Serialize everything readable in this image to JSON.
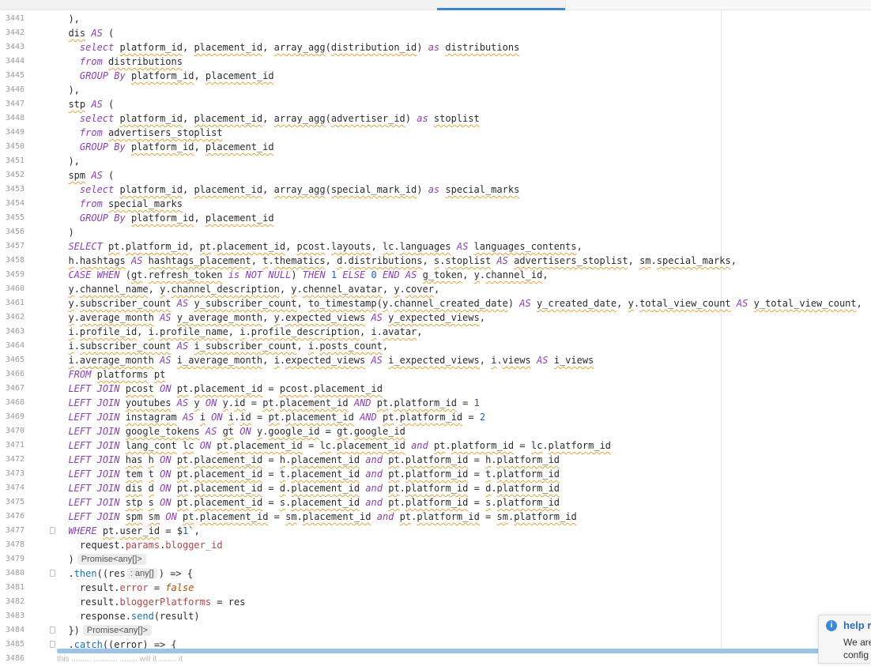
{
  "notification": {
    "title": "help r",
    "line1": "We are",
    "line2": "config"
  },
  "status_ghost": "this ......... ........... ........ will it ........ it",
  "hints": {
    "promise": "Promise<any[]>",
    "any_array": ": any[]"
  },
  "lines": [
    {
      "n": "3441",
      "text": "  ),"
    },
    {
      "n": "3442",
      "text": "  dis AS ("
    },
    {
      "n": "3443",
      "text": "    select platform_id, placement_id, array_agg(distribution_id) as distributions"
    },
    {
      "n": "3444",
      "text": "    from distributions"
    },
    {
      "n": "3445",
      "text": "    GROUP By platform_id, placement_id"
    },
    {
      "n": "3446",
      "text": "  ),"
    },
    {
      "n": "3447",
      "text": "  stp AS ("
    },
    {
      "n": "3448",
      "text": "    select platform_id, placement_id, array_agg(advertiser_id) as stoplist"
    },
    {
      "n": "3449",
      "text": "    from advertisers_stoplist"
    },
    {
      "n": "3450",
      "text": "    GROUP By platform_id, placement_id"
    },
    {
      "n": "3451",
      "text": "  ),"
    },
    {
      "n": "3452",
      "text": "  spm AS ("
    },
    {
      "n": "3453",
      "text": "    select platform_id, placement_id, array_agg(special_mark_id) as special_marks"
    },
    {
      "n": "3454",
      "text": "    from special_marks"
    },
    {
      "n": "3455",
      "text": "    GROUP By platform_id, placement_id"
    },
    {
      "n": "3456",
      "text": "  )"
    },
    {
      "n": "3457",
      "text": "  SELECT pt.platform_id, pt.placement_id, pcost.layouts, lc.languages AS languages_contents,"
    },
    {
      "n": "3458",
      "text": "  h.hashtags AS hashtags_placement, t.thematics, d.distributions, s.stoplist AS advertisers_stoplist, sm.special_marks,"
    },
    {
      "n": "3459",
      "text": "  CASE WHEN (gt.refresh_token is NOT NULL) THEN 1 ELSE 0 END AS g_token, y.channel_id,"
    },
    {
      "n": "3460",
      "text": "  y.channel_name, y.channel_description, y.chennel_avatar, y.cover,"
    },
    {
      "n": "3461",
      "text": "  y.subscriber_count AS y_subscriber_count, to_timestamp(y.channel_created_date) AS y_created_date, y.total_view_count AS y_total_view_count,"
    },
    {
      "n": "3462",
      "text": "  y.average_month AS y_average_month, y.expected_views AS y_expected_views,"
    },
    {
      "n": "3463",
      "text": "  i.profile_id, i.profile_name, i.profile_description, i.avatar,"
    },
    {
      "n": "3464",
      "text": "  i.subscriber_count AS i_subscriber_count, i.posts_count,"
    },
    {
      "n": "3465",
      "text": "  i.average_month AS i_average_month, i.expected_views AS i_expected_views, i.views AS i_views"
    },
    {
      "n": "3466",
      "text": "  FROM platforms pt"
    },
    {
      "n": "3467",
      "text": "  LEFT JOIN pcost ON pt.placement_id = pcost.placement_id"
    },
    {
      "n": "3468",
      "text": "  LEFT JOIN youtubes AS y ON y.id = pt.placement_id AND pt.platform_id = 1"
    },
    {
      "n": "3469",
      "text": "  LEFT JOIN instagram AS i ON i.id = pt.placement_id AND pt.platform_id = 2"
    },
    {
      "n": "3470",
      "text": "  LEFT JOIN google_tokens AS gt ON y.google_id = gt.google_id"
    },
    {
      "n": "3471",
      "text": "  LEFT JOIN lang_cont lc ON pt.placement_id = lc.placement_id and pt.platform_id = lc.platform_id"
    },
    {
      "n": "3472",
      "text": "  LEFT JOIN has h ON pt.placement_id = h.placement_id and pt.platform_id = h.platform_id"
    },
    {
      "n": "3473",
      "text": "  LEFT JOIN tem t ON pt.placement_id = t.placement_id and pt.platform_id = t.platform_id"
    },
    {
      "n": "3474",
      "text": "  LEFT JOIN dis d ON pt.placement_id = d.placement_id and pt.platform_id = d.platform_id"
    },
    {
      "n": "3475",
      "text": "  LEFT JOIN stp s ON pt.placement_id = s.placement_id and pt.platform_id = s.platform_id"
    },
    {
      "n": "3476",
      "text": "  LEFT JOIN spm sm ON pt.placement_id = sm.placement_id and pt.platform_id = sm.platform_id"
    },
    {
      "n": "3477",
      "text": "  WHERE pt.user_id = $1`,"
    },
    {
      "n": "3478",
      "text": "    request.params.blogger_id"
    },
    {
      "n": "3479",
      "text": "  )"
    },
    {
      "n": "3480",
      "text": "  .then((res) => {"
    },
    {
      "n": "3481",
      "text": "    result.error = false"
    },
    {
      "n": "3482",
      "text": "    result.bloggerPlatforms = res"
    },
    {
      "n": "3483",
      "text": "    response.send(result)"
    },
    {
      "n": "3484",
      "text": "  })"
    },
    {
      "n": "3485",
      "text": "  .catch((error) => {"
    },
    {
      "n": "3486",
      "text": ""
    }
  ]
}
